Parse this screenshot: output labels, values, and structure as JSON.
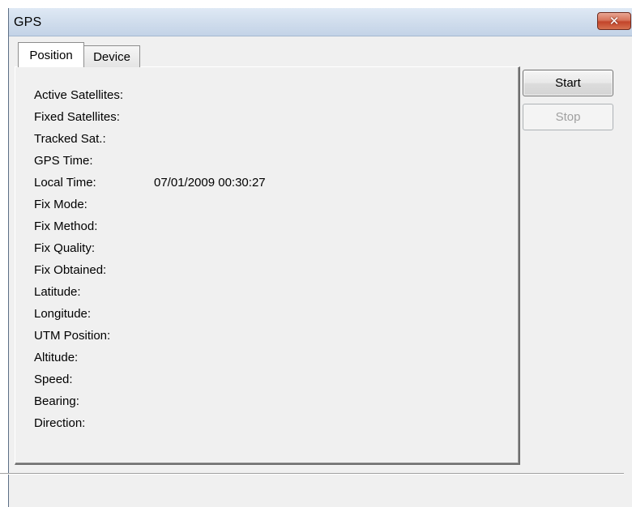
{
  "window": {
    "title": "GPS",
    "close_glyph": "✕"
  },
  "tabs": [
    {
      "label": "Position",
      "selected": true
    },
    {
      "label": "Device",
      "selected": false
    }
  ],
  "buttons": {
    "start_label": "Start",
    "stop_label": "Stop",
    "stop_enabled": false
  },
  "fields": [
    {
      "label": "Active Satellites:",
      "value": ""
    },
    {
      "label": "Fixed Satellites:",
      "value": ""
    },
    {
      "label": "Tracked Sat.:",
      "value": ""
    },
    {
      "label": "GPS Time:",
      "value": ""
    },
    {
      "label": "Local Time:",
      "value": "07/01/2009 00:30:27"
    },
    {
      "label": "Fix Mode:",
      "value": ""
    },
    {
      "label": "Fix Method:",
      "value": ""
    },
    {
      "label": "Fix Quality:",
      "value": ""
    },
    {
      "label": "Fix Obtained:",
      "value": ""
    },
    {
      "label": "Latitude:",
      "value": ""
    },
    {
      "label": "Longitude:",
      "value": ""
    },
    {
      "label": "UTM Position:",
      "value": ""
    },
    {
      "label": "Altitude:",
      "value": ""
    },
    {
      "label": "Speed:",
      "value": ""
    },
    {
      "label": "Bearing:",
      "value": ""
    },
    {
      "label": "Direction:",
      "value": ""
    }
  ]
}
